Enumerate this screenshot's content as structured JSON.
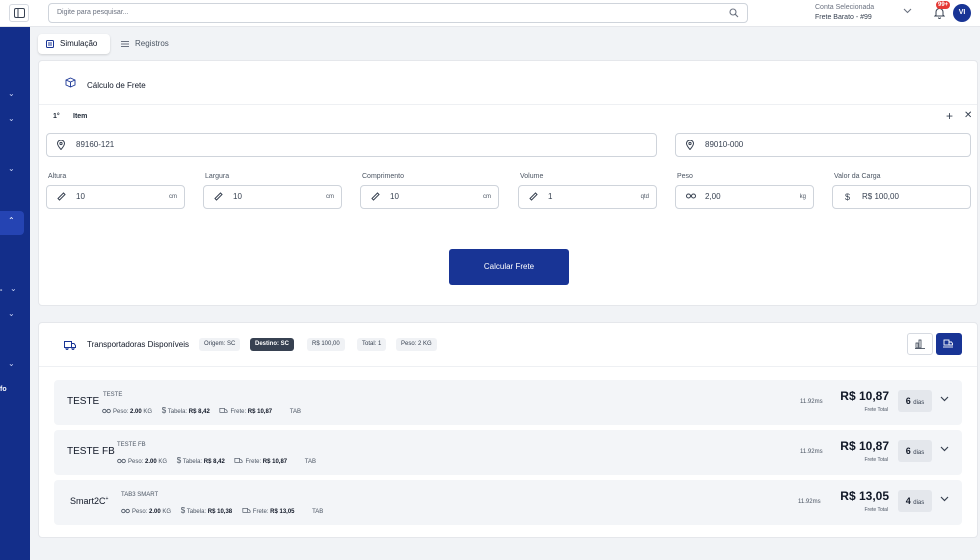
{
  "header": {
    "search_placeholder": "Digite para pesquisar...",
    "account_label": "Conta Selecionada",
    "account_value": "Frete Barato - #99",
    "notification_badge": "99+",
    "avatar_initials": "VI"
  },
  "sidebar": {
    "fragment_1": "-",
    "fragment_2": "fo"
  },
  "tabs": [
    {
      "label": "Simulação",
      "active": true
    },
    {
      "label": "Registros",
      "active": false
    }
  ],
  "calculator": {
    "title": "Cálculo de Frete",
    "item_number": "1°",
    "item_label": "Item",
    "origin_cep": "89160-121",
    "destination_cep": "89010-000",
    "fields": [
      {
        "label": "Altura",
        "value": "10",
        "unit": "cm"
      },
      {
        "label": "Largura",
        "value": "10",
        "unit": "cm"
      },
      {
        "label": "Comprimento",
        "value": "10",
        "unit": "cm"
      },
      {
        "label": "Volume",
        "value": "1",
        "unit": "qtd"
      },
      {
        "label": "Peso",
        "value": "2,00",
        "unit": "kg"
      },
      {
        "label": "Valor da Carga",
        "value": "R$ 100,00",
        "unit": ""
      }
    ],
    "button_label": "Calcular Frete"
  },
  "carriers": {
    "title": "Transportadoras Disponíveis",
    "chips": [
      "Origem: SC",
      "Destino: SC",
      "R$ 100,00",
      "Total: 1",
      "Peso: 2 KG"
    ],
    "rows": [
      {
        "name": "TESTE",
        "subtitle": "TESTE",
        "peso_label": "Peso:",
        "peso_value": "2.00",
        "peso_unit": "KG",
        "tabela_label": "Tabela:",
        "tabela_value": "R$ 8,42",
        "frete_label": "Frete:",
        "frete_value": "R$ 10,87",
        "tag": "TAB",
        "time": "11.92ms",
        "price": "R$ 10,87",
        "price_label": "Frete Total",
        "days": "6",
        "days_unit": "dias"
      },
      {
        "name": "TESTE FB",
        "subtitle": "TESTE FB",
        "peso_label": "Peso:",
        "peso_value": "2.00",
        "peso_unit": "KG",
        "tabela_label": "Tabela:",
        "tabela_value": "R$ 8,42",
        "frete_label": "Frete:",
        "frete_value": "R$ 10,87",
        "tag": "TAB",
        "time": "11.92ms",
        "price": "R$ 10,87",
        "price_label": "Frete Total",
        "days": "6",
        "days_unit": "dias"
      },
      {
        "name": "Smart2C",
        "subtitle": "TAB3 SMART",
        "peso_label": "Peso:",
        "peso_value": "2.00",
        "peso_unit": "KG",
        "tabela_label": "Tabela:",
        "tabela_value": "R$ 10,38",
        "frete_label": "Frete:",
        "frete_value": "R$ 13,05",
        "tag": "TAB",
        "time": "11.92ms",
        "price": "R$ 13,05",
        "price_label": "Frete Total",
        "days": "4",
        "days_unit": "dias"
      }
    ]
  },
  "colors": {
    "primary": "#183495",
    "sidebar": "#132e8a",
    "badge": "#e53935"
  }
}
